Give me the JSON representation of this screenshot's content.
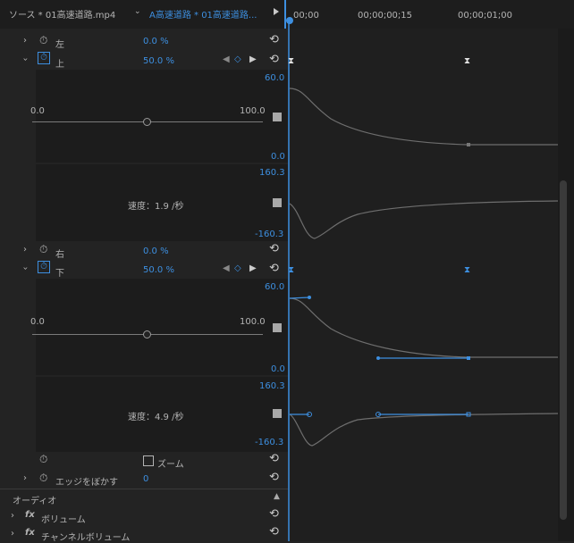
{
  "header": {
    "source_tab": "ソース * 01高速道路.mp4",
    "seq_tab": "A高速道路 * 01高速道路...",
    "time_labels": [
      "00;00",
      "00;00;00;15",
      "00;00;01;00"
    ]
  },
  "properties": {
    "left": {
      "label": "左",
      "value": "0.0 %"
    },
    "top": {
      "label": "上",
      "value": "50.0 %",
      "graph_max": "60.0",
      "graph_min": "0.0",
      "slider_min": "0.0",
      "slider_max": "100.0",
      "slider_value": 0.5,
      "speed_label": "速度：1.9 /秒",
      "speed_max": "160.3",
      "speed_min": "-160.3"
    },
    "right": {
      "label": "右",
      "value": "0.0 %"
    },
    "bottom": {
      "label": "下",
      "value": "50.0 %",
      "graph_max": "60.0",
      "graph_min": "0.0",
      "slider_min": "0.0",
      "slider_max": "100.0",
      "slider_value": 0.5,
      "speed_label": "速度：4.9 /秒",
      "speed_max": "160.3",
      "speed_min": "-160.3"
    },
    "zoom": {
      "label": "ズーム"
    },
    "edge_feather": {
      "label": "エッジをぼかす",
      "value": "0"
    }
  },
  "audio": {
    "section_label": "オーディオ",
    "volume": {
      "label": "ボリューム",
      "fx": "fx"
    },
    "channel_volume": {
      "label": "チャンネルボリューム",
      "fx": "fx"
    }
  },
  "colors": {
    "accent": "#3d8fe0",
    "background": "#232323",
    "curve": "#6e6e6e"
  }
}
